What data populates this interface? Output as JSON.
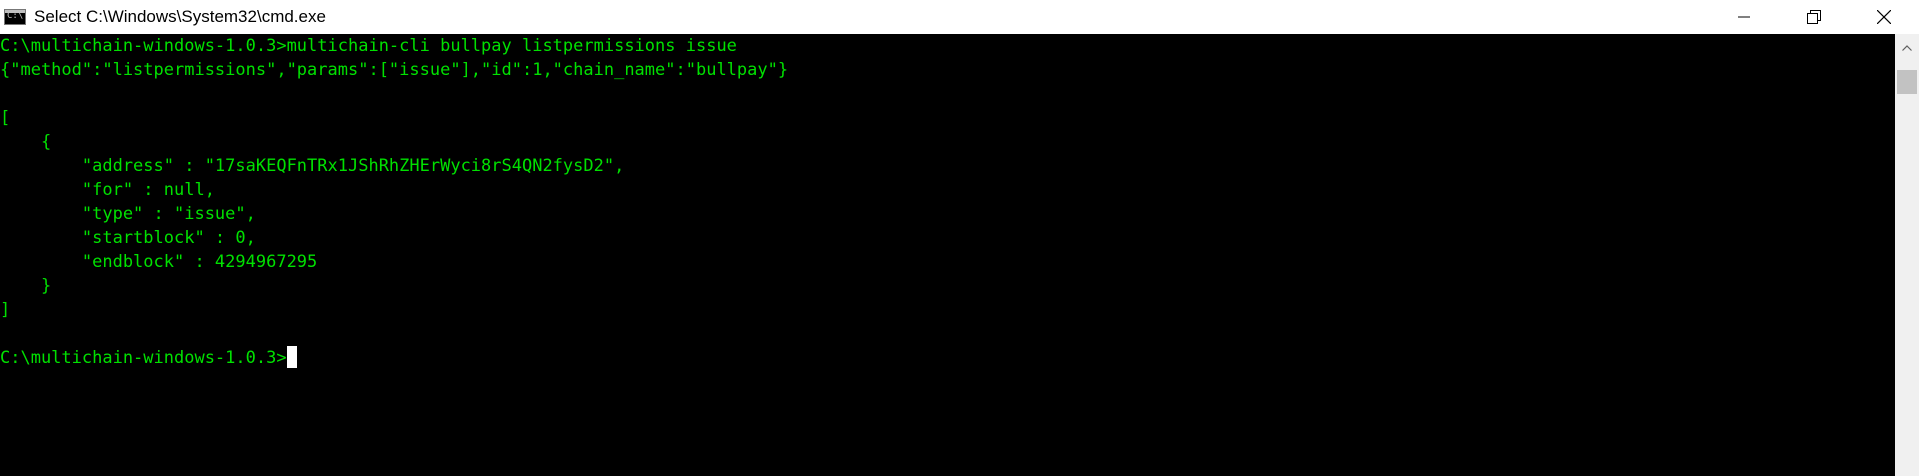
{
  "window": {
    "title": "Select C:\\Windows\\System32\\cmd.exe",
    "controls": {
      "minimize": "minimize-icon",
      "maximize": "restore-icon",
      "close": "close-icon"
    }
  },
  "console": {
    "text_color": "#00e000",
    "background": "#000000",
    "lines": [
      "C:\\multichain-windows-1.0.3>multichain-cli bullpay listpermissions issue",
      "{\"method\":\"listpermissions\",\"params\":[\"issue\"],\"id\":1,\"chain_name\":\"bullpay\"}",
      "",
      "[",
      "    {",
      "        \"address\" : \"17saKEQFnTRx1JShRhZHErWyci8rS4QN2fysD2\",",
      "        \"for\" : null,",
      "        \"type\" : \"issue\",",
      "        \"startblock\" : 0,",
      "        \"endblock\" : 4294967295",
      "    }",
      "]",
      ""
    ],
    "prompt": "C:\\multichain-windows-1.0.3>"
  }
}
